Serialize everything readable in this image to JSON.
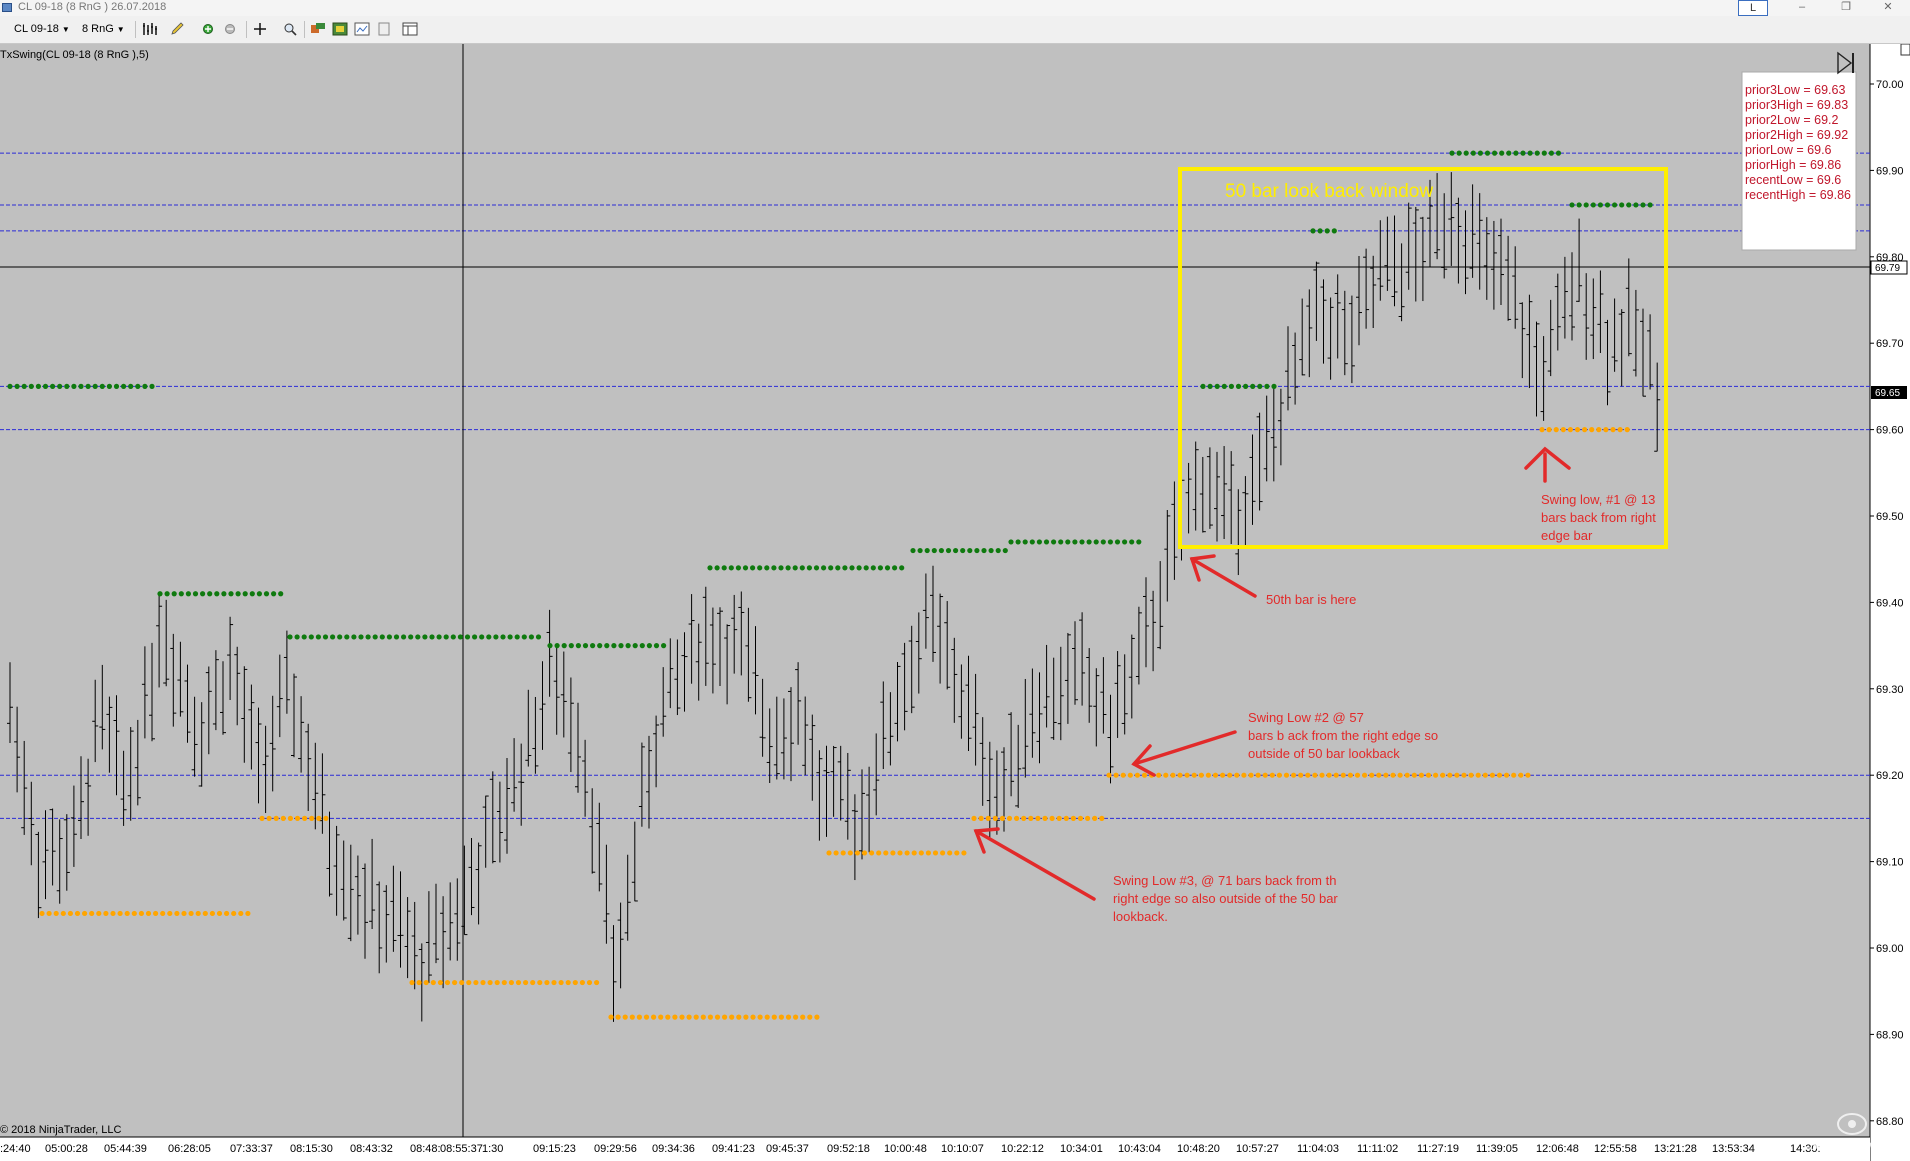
{
  "window": {
    "title": "CL 09-18 (8 RnG ) 26.07.2018",
    "button_l": "L",
    "minimize": "–",
    "restore": "❐",
    "close": "✕"
  },
  "toolbar": {
    "instrument": "CL 09-18",
    "bar_type": "8 RnG"
  },
  "chart": {
    "indicator_label": "TxSwing(CL 09-18 (8 RnG ),5)",
    "copyright": "© 2018 NinjaTrader, LLC",
    "watermark": "Screenshot",
    "price_tag_current": "69.79",
    "price_tag_last": "69.65",
    "info_box": [
      "prior3Low = 69.63",
      "prior3High = 69.83",
      "prior2Low = 69.2",
      "prior2High = 69.92",
      "priorLow = 69.6",
      "priorHigh = 69.86",
      "recentLow = 69.6",
      "recentHigh = 69.86"
    ],
    "annotations": {
      "box_title": "50 bar look back window",
      "bar50": "50th bar is here",
      "swing1": [
        "Swing low, #1 @ 13",
        "bars back from right",
        "edge bar"
      ],
      "swing2": [
        "Swing Low #2 @ 57",
        "bars b ack from the right edge so",
        "outside of 50 bar lookback"
      ],
      "swing3": [
        "Swing Low #3, @ 71 bars back from th",
        "right edge so also outside of the 50 bar",
        "lookback."
      ]
    },
    "colors": {
      "background": "#c0c0c0",
      "swing_high": "#0f7a0f",
      "swing_low": "#ffa500",
      "lookback_box": "#ffee00",
      "annotation": "#e22a2a",
      "level_line": "#2b2bd6"
    }
  },
  "chart_data": {
    "type": "ohlc",
    "y_ticks": [
      "70.00",
      "69.90",
      "69.80",
      "69.70",
      "69.60",
      "69.50",
      "69.40",
      "69.30",
      "69.20",
      "69.10",
      "69.00",
      "68.90",
      "68.80"
    ],
    "x_ticks": [
      ":24:40",
      "05:00:28",
      "05:44:39",
      "06:28:05",
      "07:33:37",
      "08:15:30",
      "08:43:32",
      "08:48:",
      "08:55:37",
      "1:30",
      "09:15:23",
      "09:29:56",
      "09:34:36",
      "09:41:23",
      "09:45:37",
      "09:52:18",
      "10:00:48",
      "10:10:07",
      "10:22:12",
      "10:34:01",
      "10:43:04",
      "10:48:20",
      "10:57:27",
      "11:04:03",
      "11:11:02",
      "11:27:19",
      "11:39:05",
      "12:06:48",
      "12:55:58",
      "13:21:28",
      "13:53:34",
      "14:30:"
    ],
    "ylim": [
      68.8,
      70.05
    ],
    "swing_highs": [
      69.65,
      69.41,
      69.36,
      69.35,
      69.44,
      69.46,
      69.47,
      69.65,
      69.83,
      69.92,
      69.86
    ],
    "swing_lows": [
      69.04,
      69.15,
      68.96,
      68.92,
      69.11,
      69.15,
      69.2,
      69.6
    ],
    "level_lines": [
      69.92,
      69.86,
      69.83,
      69.65,
      69.6,
      69.2,
      69.15
    ],
    "last_price": 69.65
  }
}
